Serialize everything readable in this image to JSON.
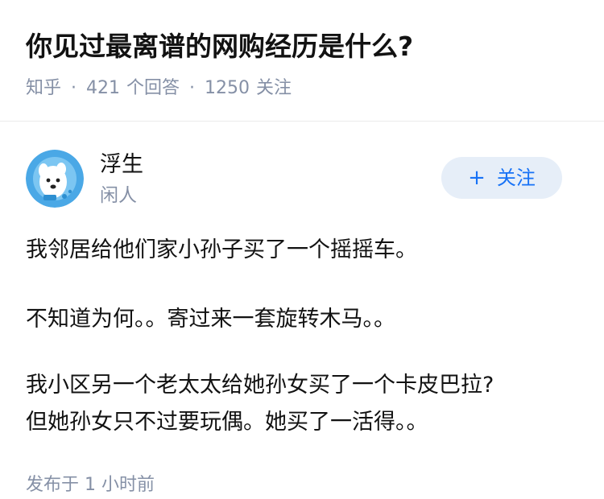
{
  "question": {
    "title": "你见过最离谱的网购经历是什么?",
    "source": "知乎",
    "separator": "·",
    "answer_count": "421",
    "answer_label": "个回答",
    "follower_count": "1250",
    "follower_label": "关注"
  },
  "author": {
    "name": "浮生",
    "headline": "闲人",
    "follow_plus": "+",
    "follow_label": "关注"
  },
  "answer": {
    "paragraph_1": "我邻居给他们家小孙子买了一个摇摇车。",
    "paragraph_2": "不知道为何。。寄过来一套旋转木马。。",
    "paragraph_3_line_1": "我小区另一个老太太给她孙女买了一个卡皮巴拉?",
    "paragraph_3_line_2": "但她孙女只不过要玩偶。她买了一活得。。",
    "publish_time": "发布于 1 小时前"
  },
  "colors": {
    "title": "#121212",
    "meta": "#8590a6",
    "follow_bg": "#e6eef8",
    "follow_text": "#1772f6",
    "avatar_bg": "#4aa8e6"
  },
  "icons": {
    "avatar": "cartoon-dog-astronaut-avatar"
  }
}
